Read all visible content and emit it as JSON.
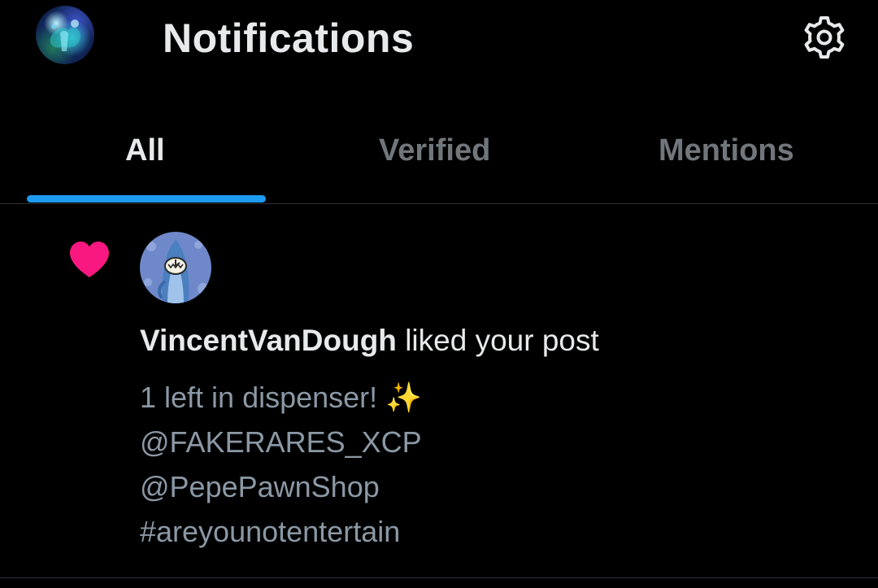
{
  "header": {
    "title": "Notifications",
    "avatar_icon": "user-avatar-icon",
    "settings_icon": "gear-icon"
  },
  "tabs": [
    {
      "label": "All",
      "active": true
    },
    {
      "label": "Verified",
      "active": false
    },
    {
      "label": "Mentions",
      "active": false
    }
  ],
  "notification": {
    "type_icon": "heart-icon",
    "user": "VincentVanDough",
    "action": " liked your post",
    "post_lines": [
      "1 left in dispenser! ✨",
      "@FAKERARES_XCP",
      "@PepePawnShop",
      "#areyounotentertain"
    ]
  },
  "colors": {
    "background": "#000000",
    "accent": "#1d9bf0",
    "like": "#f91880",
    "primary_text": "#e7e9ea",
    "secondary_text": "#71767b",
    "divider": "#2f3336"
  }
}
